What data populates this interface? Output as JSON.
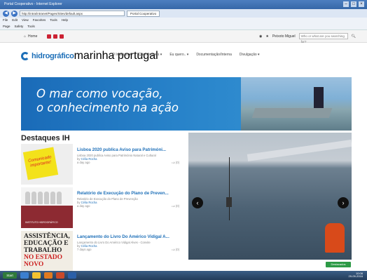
{
  "browser": {
    "title": "Portal Cooperativo - Internet Explorer",
    "url": "http://intra/intranet/Pages/Sites/default.aspx",
    "tab": "Portal Cooperativo",
    "menu": [
      "File",
      "Edit",
      "View",
      "Favorites",
      "Tools",
      "Help"
    ],
    "commands": [
      "Page",
      "Safety",
      "Tools"
    ]
  },
  "sitebar": {
    "home": "Home",
    "user": "Peixoto Miguel",
    "search_placeholder": "Who or what are you searching for?"
  },
  "header": {
    "logo_name": "hidrográfico",
    "logo_sub": "marinha portugal",
    "nav": [
      "O Instituto ▾",
      "Quem somos ▾",
      "Eu quero.. ▾",
      "Documentação/Interna",
      "Divulgação ▾"
    ]
  },
  "hero": {
    "line1": "O mar como vocação,",
    "line2": "o conhecimento na ação"
  },
  "section_title": "Destaques IH",
  "news": [
    {
      "title": "Lisboa 2020 publica Aviso para Patrimóni...",
      "desc": "Lisboa 2020 publica Aviso para Património Natural e Cultural",
      "by": "by",
      "author": "Célia Rocha",
      "date": "a day ago",
      "likes": "(0)",
      "thumb_text": "Comunicado importante!"
    },
    {
      "title": "Relatório de Execução do Plano de Preven...",
      "desc": "Relatório de Execução do Plano de Prevenção",
      "by": "by",
      "author": "Célia Rocha",
      "date": "a day ago",
      "likes": "(0)",
      "thumb_text": "INSTITUTO HIDROGRÁFICO"
    },
    {
      "title": "Lançamento do Livro Do Américo Vidigal A...",
      "desc": "Lançamento do Livro Do Américo Vidigal Alves - Convite",
      "by": "by",
      "author": "Célia Rocha",
      "date": "7 days ago",
      "likes": "(0)",
      "thumb_lines": [
        "ASSISTÊNCIA,",
        "EDUCAÇÃO E",
        "TRABALHO",
        "NO ESTADO NOVO"
      ]
    }
  ],
  "slider": {
    "prev": "‹",
    "next": "›"
  },
  "green_button": "Destacados",
  "taskbar": {
    "start": "Start",
    "clock_time": "10:08",
    "clock_date": "29-09-2016"
  }
}
